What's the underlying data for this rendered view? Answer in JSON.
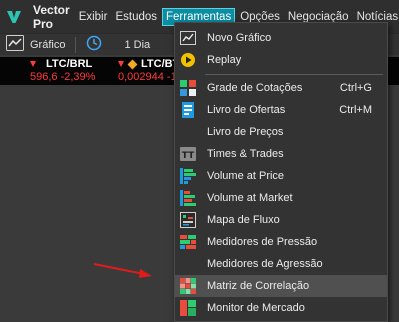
{
  "app": {
    "title": "Vector Pro"
  },
  "menubar": {
    "items": [
      "Exibir",
      "Estudos",
      "Ferramentas",
      "Opções",
      "Negociação",
      "Notícias"
    ]
  },
  "toolbar": {
    "chart_label": "Gráfico",
    "interval_label": "1 Dia"
  },
  "tickers": [
    {
      "symbol": "LTC/BRL",
      "value": "596,6 -2,39%"
    },
    {
      "symbol": "LTC/BT",
      "value": "0,002944 -1,"
    }
  ],
  "dropdown": {
    "items": [
      {
        "label": "Novo Gráfico",
        "icon": "chart-icon",
        "shortcut": ""
      },
      {
        "label": "Replay",
        "icon": "replay-icon",
        "shortcut": ""
      },
      {
        "label": "Grade de Cotações",
        "icon": "quote-grid-icon",
        "shortcut": "Ctrl+G"
      },
      {
        "label": "Livro de Ofertas",
        "icon": "order-book-icon",
        "shortcut": "Ctrl+M"
      },
      {
        "label": "Livro de Preços",
        "icon": "",
        "shortcut": ""
      },
      {
        "label": "Times & Trades",
        "icon": "times-trades-icon",
        "shortcut": ""
      },
      {
        "label": "Volume at Price",
        "icon": "volume-at-price-icon",
        "shortcut": ""
      },
      {
        "label": "Volume at Market",
        "icon": "volume-at-market-icon",
        "shortcut": ""
      },
      {
        "label": "Mapa de Fluxo",
        "icon": "flow-map-icon",
        "shortcut": ""
      },
      {
        "label": "Medidores de Pressão",
        "icon": "pressure-meter-icon",
        "shortcut": ""
      },
      {
        "label": "Medidores de Agressão",
        "icon": "",
        "shortcut": ""
      },
      {
        "label": "Matriz de Correlação",
        "icon": "correlation-matrix-icon",
        "shortcut": ""
      },
      {
        "label": "Monitor de Mercado",
        "icon": "market-monitor-icon",
        "shortcut": ""
      }
    ]
  },
  "colors": {
    "accent": "#0b8ea4",
    "negative": "#ff3b3b",
    "crypto": "#f5a623",
    "highlight": "#505050"
  }
}
